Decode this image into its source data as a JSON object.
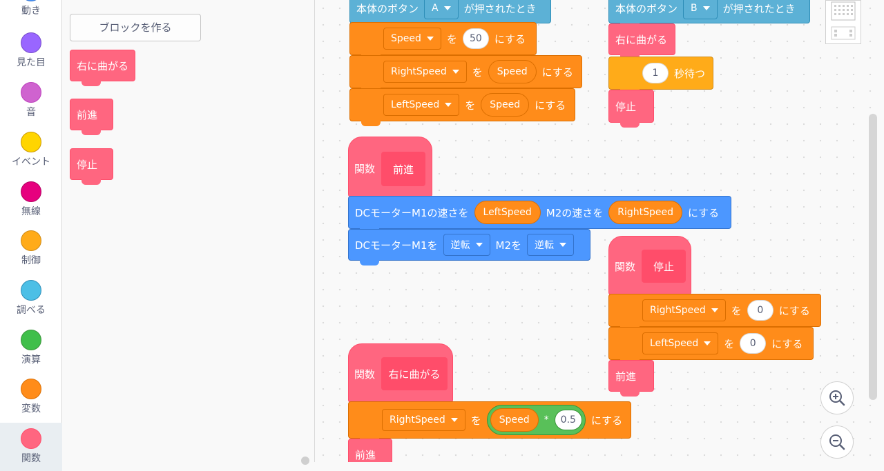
{
  "categories": [
    {
      "label": "動き",
      "color": "#4c97ff"
    },
    {
      "label": "見た目",
      "color": "#9966ff"
    },
    {
      "label": "音",
      "color": "#cf63cf"
    },
    {
      "label": "イベント",
      "color": "#ffd500"
    },
    {
      "label": "無線",
      "color": "#e6007e"
    },
    {
      "label": "制御",
      "color": "#ffab19"
    },
    {
      "label": "調べる",
      "color": "#4cbfe6"
    },
    {
      "label": "演算",
      "color": "#40bf4a"
    },
    {
      "label": "変数",
      "color": "#ff8c1a"
    },
    {
      "label": "関数",
      "color": "#ff6680"
    }
  ],
  "palette": {
    "make_block_label": "ブロックを作る",
    "blocks": [
      "右に曲がる",
      "前進",
      "停止"
    ]
  },
  "script_a": {
    "hat_text_1": "本体のボタン",
    "button_value": "A",
    "hat_text_2": "が押されたとき",
    "row1": {
      "var": "Speed",
      "wo": "を",
      "value": "50",
      "suru": "にする"
    },
    "row2": {
      "var": "RightSpeed",
      "wo": "を",
      "value": "Speed",
      "suru": "にする"
    },
    "row3": {
      "var": "LeftSpeed",
      "wo": "を",
      "value": "Speed",
      "suru": "にする"
    }
  },
  "script_b": {
    "hat_text_1": "本体のボタン",
    "button_value": "B",
    "hat_text_2": "が押されたとき",
    "call1": "右に曲がる",
    "wait_value": "1",
    "wait_label": "秒待つ",
    "call2": "停止"
  },
  "func_forward": {
    "define_label": "関数",
    "name": "前進",
    "motor_speed": {
      "prefix": "DCモーターM1の速さを",
      "m1": "LeftSpeed",
      "mid": "M2の速さを",
      "m2": "RightSpeed",
      "suru": "にする"
    },
    "motor_dir": {
      "prefix": "DCモーターM1を",
      "m1": "逆転",
      "mid": "M2を",
      "m2": "逆転"
    }
  },
  "func_stop": {
    "define_label": "関数",
    "name": "停止",
    "row1": {
      "var": "RightSpeed",
      "wo": "を",
      "value": "0",
      "suru": "にする"
    },
    "row2": {
      "var": "LeftSpeed",
      "wo": "を",
      "value": "0",
      "suru": "にする"
    },
    "call": "前進"
  },
  "func_turn": {
    "define_label": "関数",
    "name": "右に曲がる",
    "row1": {
      "var": "RightSpeed",
      "wo": "を",
      "left": "Speed",
      "op": "*",
      "right": "0.5",
      "suru": "にする"
    },
    "call": "前進"
  }
}
